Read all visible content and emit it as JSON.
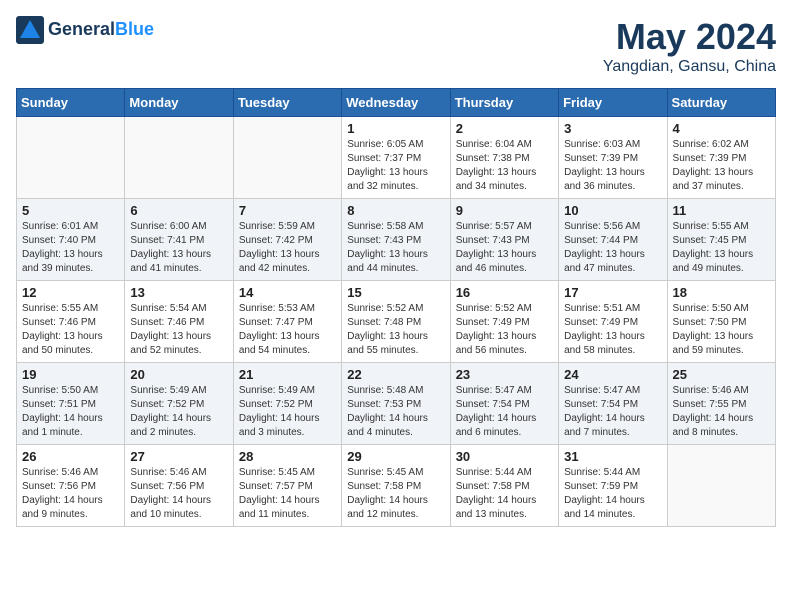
{
  "header": {
    "logo_line1": "General",
    "logo_line2": "Blue",
    "title": "May 2024",
    "subtitle": "Yangdian, Gansu, China"
  },
  "weekdays": [
    "Sunday",
    "Monday",
    "Tuesday",
    "Wednesday",
    "Thursday",
    "Friday",
    "Saturday"
  ],
  "weeks": [
    [
      {
        "day": "",
        "text": ""
      },
      {
        "day": "",
        "text": ""
      },
      {
        "day": "",
        "text": ""
      },
      {
        "day": "1",
        "text": "Sunrise: 6:05 AM\nSunset: 7:37 PM\nDaylight: 13 hours\nand 32 minutes."
      },
      {
        "day": "2",
        "text": "Sunrise: 6:04 AM\nSunset: 7:38 PM\nDaylight: 13 hours\nand 34 minutes."
      },
      {
        "day": "3",
        "text": "Sunrise: 6:03 AM\nSunset: 7:39 PM\nDaylight: 13 hours\nand 36 minutes."
      },
      {
        "day": "4",
        "text": "Sunrise: 6:02 AM\nSunset: 7:39 PM\nDaylight: 13 hours\nand 37 minutes."
      }
    ],
    [
      {
        "day": "5",
        "text": "Sunrise: 6:01 AM\nSunset: 7:40 PM\nDaylight: 13 hours\nand 39 minutes."
      },
      {
        "day": "6",
        "text": "Sunrise: 6:00 AM\nSunset: 7:41 PM\nDaylight: 13 hours\nand 41 minutes."
      },
      {
        "day": "7",
        "text": "Sunrise: 5:59 AM\nSunset: 7:42 PM\nDaylight: 13 hours\nand 42 minutes."
      },
      {
        "day": "8",
        "text": "Sunrise: 5:58 AM\nSunset: 7:43 PM\nDaylight: 13 hours\nand 44 minutes."
      },
      {
        "day": "9",
        "text": "Sunrise: 5:57 AM\nSunset: 7:43 PM\nDaylight: 13 hours\nand 46 minutes."
      },
      {
        "day": "10",
        "text": "Sunrise: 5:56 AM\nSunset: 7:44 PM\nDaylight: 13 hours\nand 47 minutes."
      },
      {
        "day": "11",
        "text": "Sunrise: 5:55 AM\nSunset: 7:45 PM\nDaylight: 13 hours\nand 49 minutes."
      }
    ],
    [
      {
        "day": "12",
        "text": "Sunrise: 5:55 AM\nSunset: 7:46 PM\nDaylight: 13 hours\nand 50 minutes."
      },
      {
        "day": "13",
        "text": "Sunrise: 5:54 AM\nSunset: 7:46 PM\nDaylight: 13 hours\nand 52 minutes."
      },
      {
        "day": "14",
        "text": "Sunrise: 5:53 AM\nSunset: 7:47 PM\nDaylight: 13 hours\nand 54 minutes."
      },
      {
        "day": "15",
        "text": "Sunrise: 5:52 AM\nSunset: 7:48 PM\nDaylight: 13 hours\nand 55 minutes."
      },
      {
        "day": "16",
        "text": "Sunrise: 5:52 AM\nSunset: 7:49 PM\nDaylight: 13 hours\nand 56 minutes."
      },
      {
        "day": "17",
        "text": "Sunrise: 5:51 AM\nSunset: 7:49 PM\nDaylight: 13 hours\nand 58 minutes."
      },
      {
        "day": "18",
        "text": "Sunrise: 5:50 AM\nSunset: 7:50 PM\nDaylight: 13 hours\nand 59 minutes."
      }
    ],
    [
      {
        "day": "19",
        "text": "Sunrise: 5:50 AM\nSunset: 7:51 PM\nDaylight: 14 hours\nand 1 minute."
      },
      {
        "day": "20",
        "text": "Sunrise: 5:49 AM\nSunset: 7:52 PM\nDaylight: 14 hours\nand 2 minutes."
      },
      {
        "day": "21",
        "text": "Sunrise: 5:49 AM\nSunset: 7:52 PM\nDaylight: 14 hours\nand 3 minutes."
      },
      {
        "day": "22",
        "text": "Sunrise: 5:48 AM\nSunset: 7:53 PM\nDaylight: 14 hours\nand 4 minutes."
      },
      {
        "day": "23",
        "text": "Sunrise: 5:47 AM\nSunset: 7:54 PM\nDaylight: 14 hours\nand 6 minutes."
      },
      {
        "day": "24",
        "text": "Sunrise: 5:47 AM\nSunset: 7:54 PM\nDaylight: 14 hours\nand 7 minutes."
      },
      {
        "day": "25",
        "text": "Sunrise: 5:46 AM\nSunset: 7:55 PM\nDaylight: 14 hours\nand 8 minutes."
      }
    ],
    [
      {
        "day": "26",
        "text": "Sunrise: 5:46 AM\nSunset: 7:56 PM\nDaylight: 14 hours\nand 9 minutes."
      },
      {
        "day": "27",
        "text": "Sunrise: 5:46 AM\nSunset: 7:56 PM\nDaylight: 14 hours\nand 10 minutes."
      },
      {
        "day": "28",
        "text": "Sunrise: 5:45 AM\nSunset: 7:57 PM\nDaylight: 14 hours\nand 11 minutes."
      },
      {
        "day": "29",
        "text": "Sunrise: 5:45 AM\nSunset: 7:58 PM\nDaylight: 14 hours\nand 12 minutes."
      },
      {
        "day": "30",
        "text": "Sunrise: 5:44 AM\nSunset: 7:58 PM\nDaylight: 14 hours\nand 13 minutes."
      },
      {
        "day": "31",
        "text": "Sunrise: 5:44 AM\nSunset: 7:59 PM\nDaylight: 14 hours\nand 14 minutes."
      },
      {
        "day": "",
        "text": ""
      }
    ]
  ]
}
